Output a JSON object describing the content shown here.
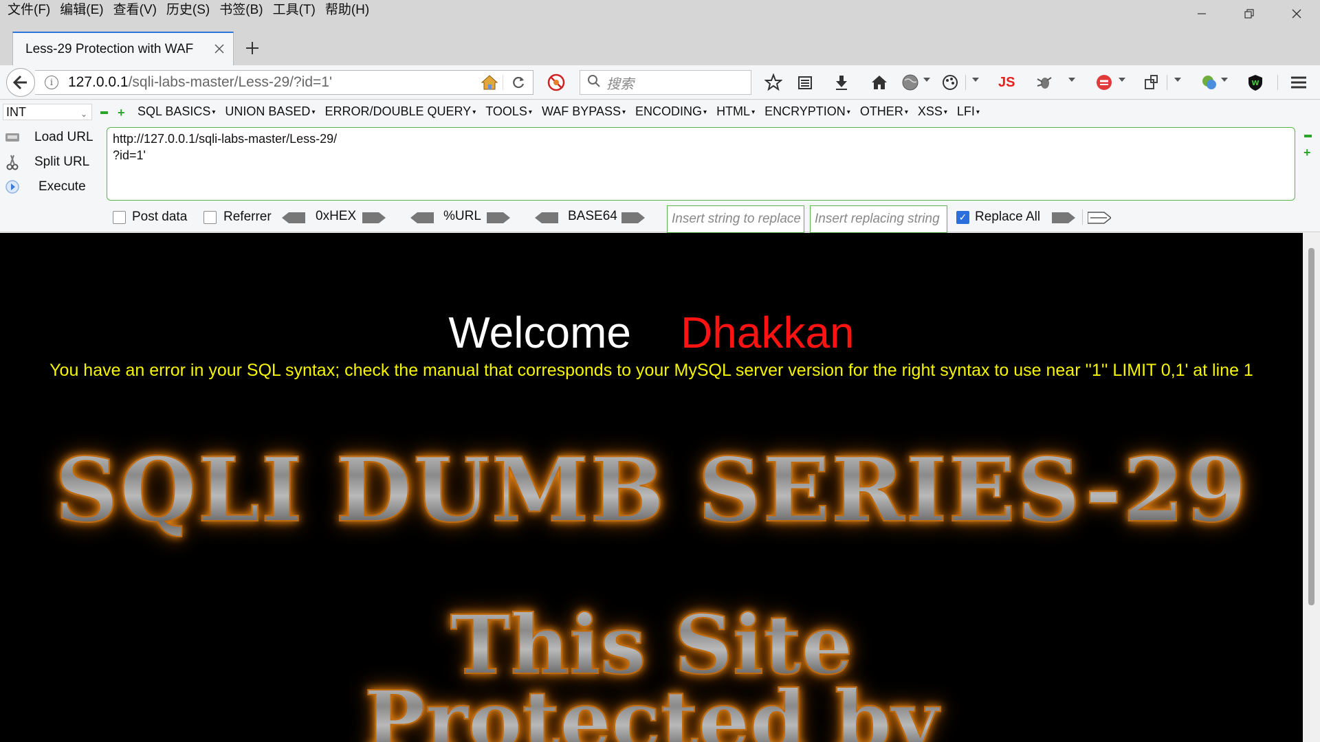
{
  "menubar": {
    "items": [
      "文件(F)",
      "编辑(E)",
      "查看(V)",
      "历史(S)",
      "书签(B)",
      "工具(T)",
      "帮助(H)"
    ]
  },
  "window_controls": [
    "minimize",
    "restore",
    "close"
  ],
  "tab": {
    "title": "Less-29 Protection with WAF"
  },
  "navbar": {
    "url_host": "127.0.0.1",
    "url_path": "/sqli-labs-master/Less-29/?id=1'",
    "search_placeholder": "搜索",
    "icons": [
      "back-icon",
      "info-icon",
      "home-icon",
      "reload-icon",
      "block-icon",
      "search-icon",
      "star-icon",
      "reader-icon",
      "download-icon",
      "home-icon",
      "globe-icon",
      "palette-icon",
      "js-icon",
      "bug-icon",
      "sync-icon",
      "share-icon",
      "translate-icon",
      "shield-icon",
      "hamburger-icon"
    ],
    "js_label": "JS"
  },
  "hackbar": {
    "select_value": "INT",
    "menu": [
      "SQL BASICS",
      "UNION BASED",
      "ERROR/DOUBLE QUERY",
      "TOOLS",
      "WAF BYPASS",
      "ENCODING",
      "HTML",
      "ENCRYPTION",
      "OTHER",
      "XSS",
      "LFI"
    ],
    "actions": {
      "load": "Load URL",
      "split": "Split URL",
      "execute": "Execute"
    },
    "textarea": "http://127.0.0.1/sqli-labs-master/Less-29/\n?id=1'",
    "post_data": "Post data",
    "referrer": "Referrer",
    "hex": "0xHEX",
    "url_enc": "%URL",
    "base64": "BASE64",
    "replace_from_placeholder": "Insert string to replace",
    "replace_to_placeholder": "Insert replacing string",
    "replace_all": "Replace All",
    "replace_all_checked": true
  },
  "page": {
    "welcome": "Welcome",
    "user": "Dhakkan",
    "error": "You have an error in your SQL syntax; check the manual that corresponds to your MySQL server version for the right syntax to use near ''1'' LIMIT 0,1' at line 1",
    "banner_title": "SQLI DUMB SERIES-29",
    "banner_line1": "This Site",
    "banner_line2": "Protected by"
  },
  "colors": {
    "page_bg": "#000000",
    "welcome": "#ffffff",
    "user": "#ff1212",
    "error": "#f5f500",
    "accent": "#2b75d9",
    "hackbar_green": "#58b44a"
  }
}
